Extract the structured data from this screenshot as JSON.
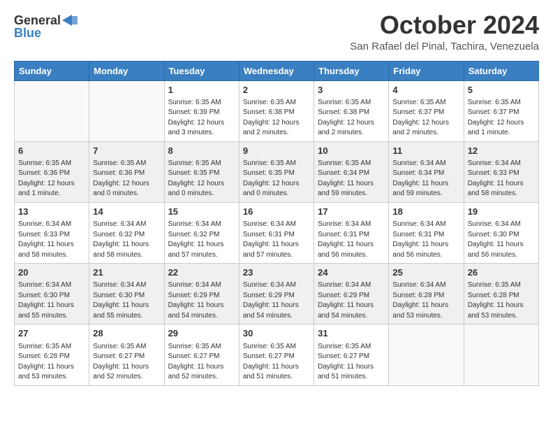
{
  "logo": {
    "general": "General",
    "blue": "Blue"
  },
  "header": {
    "month": "October 2024",
    "location": "San Rafael del Pinal, Tachira, Venezuela"
  },
  "weekdays": [
    "Sunday",
    "Monday",
    "Tuesday",
    "Wednesday",
    "Thursday",
    "Friday",
    "Saturday"
  ],
  "weeks": [
    [
      {
        "day": "",
        "sunrise": "",
        "sunset": "",
        "daylight": ""
      },
      {
        "day": "",
        "sunrise": "",
        "sunset": "",
        "daylight": ""
      },
      {
        "day": "1",
        "sunrise": "Sunrise: 6:35 AM",
        "sunset": "Sunset: 6:39 PM",
        "daylight": "Daylight: 12 hours and 3 minutes."
      },
      {
        "day": "2",
        "sunrise": "Sunrise: 6:35 AM",
        "sunset": "Sunset: 6:38 PM",
        "daylight": "Daylight: 12 hours and 2 minutes."
      },
      {
        "day": "3",
        "sunrise": "Sunrise: 6:35 AM",
        "sunset": "Sunset: 6:38 PM",
        "daylight": "Daylight: 12 hours and 2 minutes."
      },
      {
        "day": "4",
        "sunrise": "Sunrise: 6:35 AM",
        "sunset": "Sunset: 6:37 PM",
        "daylight": "Daylight: 12 hours and 2 minutes."
      },
      {
        "day": "5",
        "sunrise": "Sunrise: 6:35 AM",
        "sunset": "Sunset: 6:37 PM",
        "daylight": "Daylight: 12 hours and 1 minute."
      }
    ],
    [
      {
        "day": "6",
        "sunrise": "Sunrise: 6:35 AM",
        "sunset": "Sunset: 6:36 PM",
        "daylight": "Daylight: 12 hours and 1 minute."
      },
      {
        "day": "7",
        "sunrise": "Sunrise: 6:35 AM",
        "sunset": "Sunset: 6:36 PM",
        "daylight": "Daylight: 12 hours and 0 minutes."
      },
      {
        "day": "8",
        "sunrise": "Sunrise: 6:35 AM",
        "sunset": "Sunset: 6:35 PM",
        "daylight": "Daylight: 12 hours and 0 minutes."
      },
      {
        "day": "9",
        "sunrise": "Sunrise: 6:35 AM",
        "sunset": "Sunset: 6:35 PM",
        "daylight": "Daylight: 12 hours and 0 minutes."
      },
      {
        "day": "10",
        "sunrise": "Sunrise: 6:35 AM",
        "sunset": "Sunset: 6:34 PM",
        "daylight": "Daylight: 11 hours and 59 minutes."
      },
      {
        "day": "11",
        "sunrise": "Sunrise: 6:34 AM",
        "sunset": "Sunset: 6:34 PM",
        "daylight": "Daylight: 11 hours and 59 minutes."
      },
      {
        "day": "12",
        "sunrise": "Sunrise: 6:34 AM",
        "sunset": "Sunset: 6:33 PM",
        "daylight": "Daylight: 11 hours and 58 minutes."
      }
    ],
    [
      {
        "day": "13",
        "sunrise": "Sunrise: 6:34 AM",
        "sunset": "Sunset: 6:33 PM",
        "daylight": "Daylight: 11 hours and 58 minutes."
      },
      {
        "day": "14",
        "sunrise": "Sunrise: 6:34 AM",
        "sunset": "Sunset: 6:32 PM",
        "daylight": "Daylight: 11 hours and 58 minutes."
      },
      {
        "day": "15",
        "sunrise": "Sunrise: 6:34 AM",
        "sunset": "Sunset: 6:32 PM",
        "daylight": "Daylight: 11 hours and 57 minutes."
      },
      {
        "day": "16",
        "sunrise": "Sunrise: 6:34 AM",
        "sunset": "Sunset: 6:31 PM",
        "daylight": "Daylight: 11 hours and 57 minutes."
      },
      {
        "day": "17",
        "sunrise": "Sunrise: 6:34 AM",
        "sunset": "Sunset: 6:31 PM",
        "daylight": "Daylight: 11 hours and 56 minutes."
      },
      {
        "day": "18",
        "sunrise": "Sunrise: 6:34 AM",
        "sunset": "Sunset: 6:31 PM",
        "daylight": "Daylight: 11 hours and 56 minutes."
      },
      {
        "day": "19",
        "sunrise": "Sunrise: 6:34 AM",
        "sunset": "Sunset: 6:30 PM",
        "daylight": "Daylight: 11 hours and 56 minutes."
      }
    ],
    [
      {
        "day": "20",
        "sunrise": "Sunrise: 6:34 AM",
        "sunset": "Sunset: 6:30 PM",
        "daylight": "Daylight: 11 hours and 55 minutes."
      },
      {
        "day": "21",
        "sunrise": "Sunrise: 6:34 AM",
        "sunset": "Sunset: 6:30 PM",
        "daylight": "Daylight: 11 hours and 55 minutes."
      },
      {
        "day": "22",
        "sunrise": "Sunrise: 6:34 AM",
        "sunset": "Sunset: 6:29 PM",
        "daylight": "Daylight: 11 hours and 54 minutes."
      },
      {
        "day": "23",
        "sunrise": "Sunrise: 6:34 AM",
        "sunset": "Sunset: 6:29 PM",
        "daylight": "Daylight: 11 hours and 54 minutes."
      },
      {
        "day": "24",
        "sunrise": "Sunrise: 6:34 AM",
        "sunset": "Sunset: 6:29 PM",
        "daylight": "Daylight: 11 hours and 54 minutes."
      },
      {
        "day": "25",
        "sunrise": "Sunrise: 6:34 AM",
        "sunset": "Sunset: 6:28 PM",
        "daylight": "Daylight: 11 hours and 53 minutes."
      },
      {
        "day": "26",
        "sunrise": "Sunrise: 6:35 AM",
        "sunset": "Sunset: 6:28 PM",
        "daylight": "Daylight: 11 hours and 53 minutes."
      }
    ],
    [
      {
        "day": "27",
        "sunrise": "Sunrise: 6:35 AM",
        "sunset": "Sunset: 6:28 PM",
        "daylight": "Daylight: 11 hours and 53 minutes."
      },
      {
        "day": "28",
        "sunrise": "Sunrise: 6:35 AM",
        "sunset": "Sunset: 6:27 PM",
        "daylight": "Daylight: 11 hours and 52 minutes."
      },
      {
        "day": "29",
        "sunrise": "Sunrise: 6:35 AM",
        "sunset": "Sunset: 6:27 PM",
        "daylight": "Daylight: 11 hours and 52 minutes."
      },
      {
        "day": "30",
        "sunrise": "Sunrise: 6:35 AM",
        "sunset": "Sunset: 6:27 PM",
        "daylight": "Daylight: 11 hours and 51 minutes."
      },
      {
        "day": "31",
        "sunrise": "Sunrise: 6:35 AM",
        "sunset": "Sunset: 6:27 PM",
        "daylight": "Daylight: 11 hours and 51 minutes."
      },
      {
        "day": "",
        "sunrise": "",
        "sunset": "",
        "daylight": ""
      },
      {
        "day": "",
        "sunrise": "",
        "sunset": "",
        "daylight": ""
      }
    ]
  ]
}
